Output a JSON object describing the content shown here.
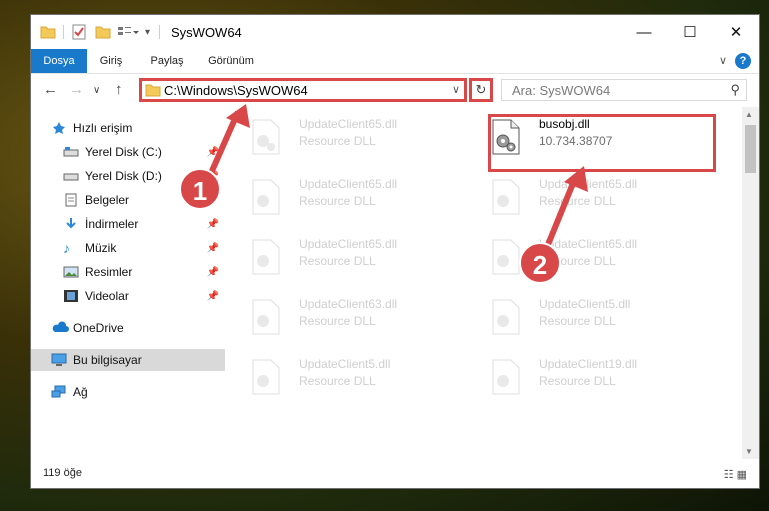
{
  "window": {
    "title": "SysWOW64"
  },
  "ribbon": {
    "tabs": [
      "Dosya",
      "Giriş",
      "Paylaş",
      "Görünüm"
    ]
  },
  "address": {
    "path": "C:\\Windows\\SysWOW64",
    "search_placeholder": "Ara: SysWOW64"
  },
  "sidebar": {
    "items": [
      {
        "label": "Hızlı erişim",
        "icon": "star-icon"
      },
      {
        "label": "Yerel Disk (C:)",
        "icon": "drive-icon"
      },
      {
        "label": "Yerel Disk (D:)",
        "icon": "drive-icon"
      },
      {
        "label": "Belgeler",
        "icon": "documents-icon"
      },
      {
        "label": "İndirmeler",
        "icon": "download-icon"
      },
      {
        "label": "Müzik",
        "icon": "music-icon"
      },
      {
        "label": "Resimler",
        "icon": "pictures-icon"
      },
      {
        "label": "Videolar",
        "icon": "videos-icon"
      },
      {
        "label": "OneDrive",
        "icon": "cloud-icon"
      },
      {
        "label": "Bu bilgisayar",
        "icon": "computer-icon"
      },
      {
        "label": "Ağ",
        "icon": "network-icon"
      }
    ]
  },
  "files": [
    {
      "name": "UpdateClient65.dll",
      "desc": "Resource DLL"
    },
    {
      "name": "busobj.dll",
      "desc": "10.734.38707"
    },
    {
      "name": "UpdateClient65.dll",
      "desc": "Resource DLL"
    },
    {
      "name": "UpdateClient65.dll",
      "desc": "Resource DLL"
    },
    {
      "name": "UpdateClient65.dll",
      "desc": "Resource DLL"
    },
    {
      "name": "UpdateClient65.dll",
      "desc": "Resource DLL"
    },
    {
      "name": "UpdateClient63.dll",
      "desc": "Resource DLL"
    },
    {
      "name": "UpdateClient5.dll",
      "desc": "Resource DLL"
    },
    {
      "name": "UpdateClient5.dll",
      "desc": "Resource DLL"
    },
    {
      "name": "UpdateClient19.dll",
      "desc": "Resource DLL"
    }
  ],
  "status": {
    "count": "119 öğe"
  },
  "annotations": {
    "step1": "1",
    "step2": "2"
  },
  "colors": {
    "accent": "#1979ca",
    "highlight": "#d94848"
  }
}
